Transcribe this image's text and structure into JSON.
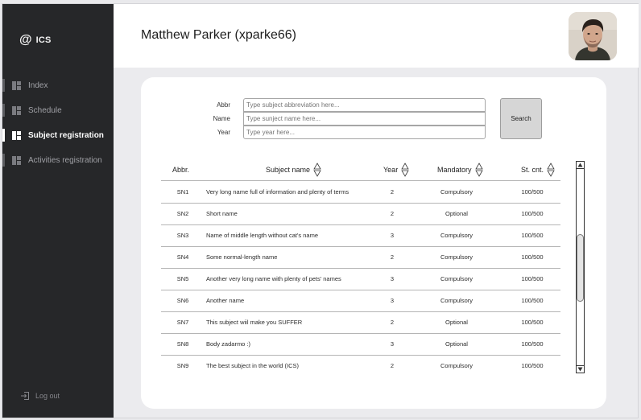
{
  "app": {
    "logo_symbol": "@",
    "logo_text": "ICS"
  },
  "sidebar": {
    "items": [
      {
        "label": "Index",
        "active": false
      },
      {
        "label": "Schedule",
        "active": false
      },
      {
        "label": "Subject registration",
        "active": true
      },
      {
        "label": "Activities registration",
        "active": false
      }
    ],
    "logout_label": "Log out"
  },
  "header": {
    "title": "Matthew Parker (xparke66)"
  },
  "filters": {
    "abbr_label": "Abbr",
    "abbr_placeholder": "Type subject abbreviation here...",
    "name_label": "Name",
    "name_placeholder": "Type sunject name here...",
    "year_label": "Year",
    "year_placeholder": "Type year here...",
    "search_label": "Search"
  },
  "table": {
    "headers": {
      "abbr": "Abbr.",
      "name": "Subject name",
      "year": "Year",
      "mandatory": "Mandatory",
      "count": "St. cnt."
    },
    "rows": [
      {
        "abbr": "SN1",
        "name": "Very long name full of information and plenty of terms",
        "year": "2",
        "mandatory": "Compulsory",
        "count": "100/500"
      },
      {
        "abbr": "SN2",
        "name": "Short name",
        "year": "2",
        "mandatory": "Optional",
        "count": "100/500"
      },
      {
        "abbr": "SN3",
        "name": "Name of middle length without cat's name",
        "year": "3",
        "mandatory": "Compulsory",
        "count": "100/500"
      },
      {
        "abbr": "SN4",
        "name": "Some normal-length name",
        "year": "2",
        "mandatory": "Compulsory",
        "count": "100/500"
      },
      {
        "abbr": "SN5",
        "name": "Another very long name with plenty of pets' names",
        "year": "3",
        "mandatory": "Compulsory",
        "count": "100/500"
      },
      {
        "abbr": "SN6",
        "name": "Another name",
        "year": "3",
        "mandatory": "Compulsory",
        "count": "100/500"
      },
      {
        "abbr": "SN7",
        "name": "This subject wiil make you SUFFER",
        "year": "2",
        "mandatory": "Optional",
        "count": "100/500"
      },
      {
        "abbr": "SN8",
        "name": "Body zadarmo :)",
        "year": "3",
        "mandatory": "Optional",
        "count": "100/500"
      },
      {
        "abbr": "SN9",
        "name": "The best subject in the world (ICS)",
        "year": "2",
        "mandatory": "Compulsory",
        "count": "100/500"
      }
    ]
  },
  "colors": {
    "sidebar_bg": "#262729",
    "page_bg": "#ebebee",
    "card_bg": "#ffffff",
    "active_text": "#ffffff"
  },
  "icons": {
    "nav": "dashboard-icon",
    "logout": "logout-icon",
    "sort": "sort-icon"
  }
}
